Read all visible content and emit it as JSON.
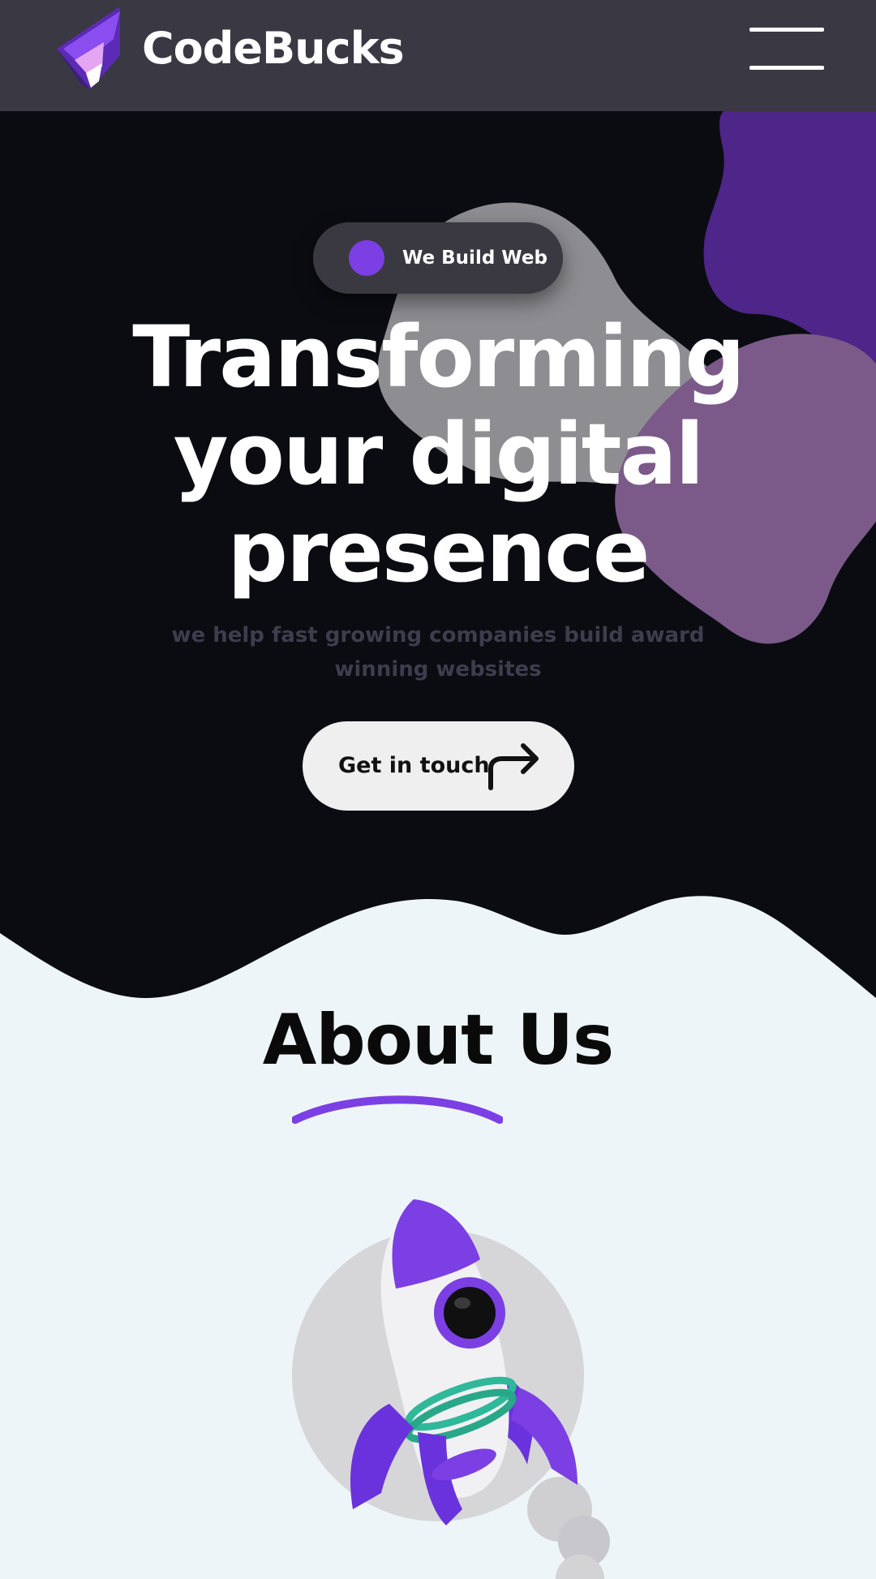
{
  "header": {
    "brand": "CodeBucks",
    "menu_icon": "hamburger-menu-icon",
    "logo_icon": "codebucks-logo-icon"
  },
  "hero": {
    "badge": "We Build Web",
    "title": "Transforming your digital presence",
    "subtitle": "we help fast growing companies build award winning websites",
    "cta_label": "Get in touch",
    "cta_icon": "arrow-turn-right-icon"
  },
  "about": {
    "title": "About Us",
    "illustration_icon": "rocket-illustration"
  },
  "colors": {
    "header_bg": "#393843",
    "hero_bg": "#0b0c11",
    "accent_purple": "#7b3fe4",
    "about_bg": "#eef5f8",
    "cta_bg": "#efefef"
  }
}
